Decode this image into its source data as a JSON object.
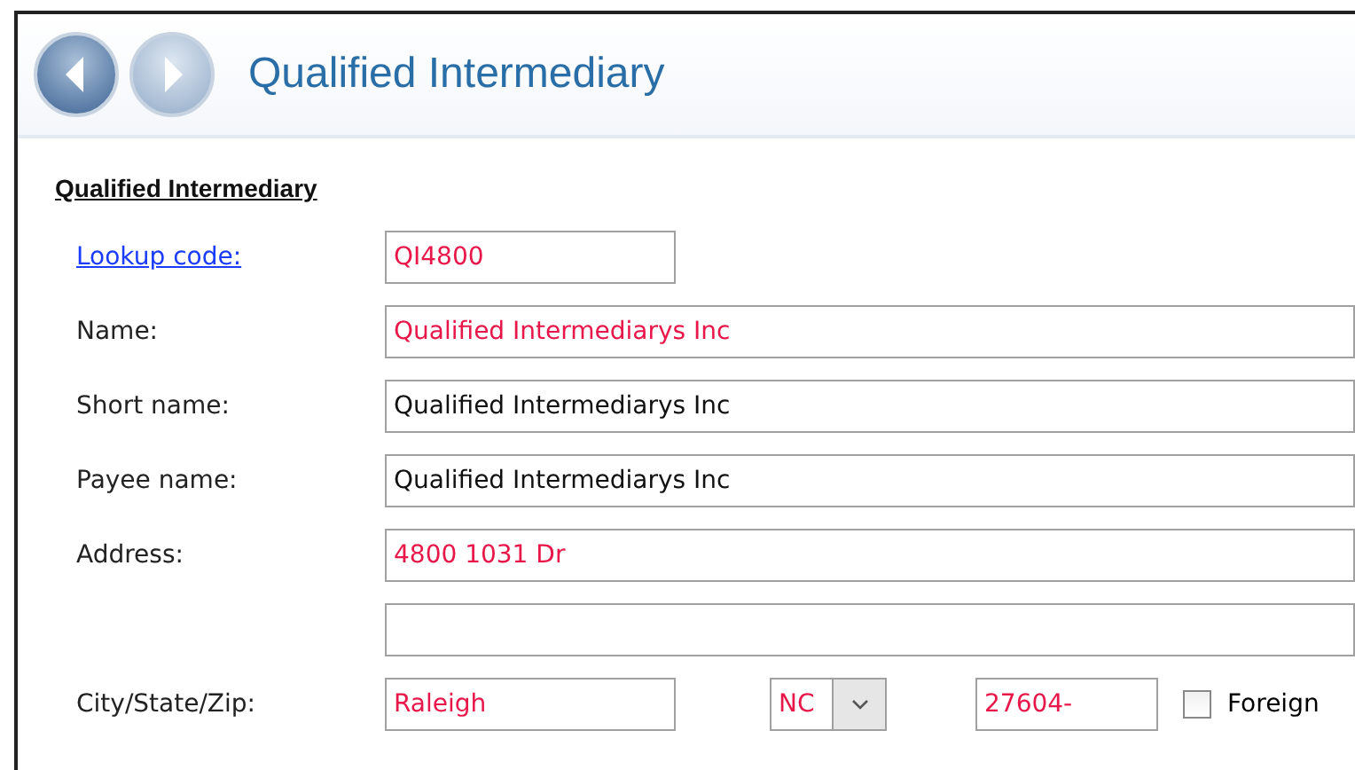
{
  "header": {
    "title": "Qualified Intermediary"
  },
  "section": {
    "title": "Qualified Intermediary"
  },
  "rows": [
    {
      "label": "Lookup code:",
      "kind": "link",
      "fields": [
        {
          "kind": "short",
          "value": "QI4800",
          "required": true
        }
      ]
    },
    {
      "label": "Name:",
      "kind": "plain",
      "fields": [
        {
          "kind": "text",
          "value": "Qualified Intermediarys Inc",
          "required": true
        }
      ]
    },
    {
      "label": "Short name:",
      "kind": "plain",
      "fields": [
        {
          "kind": "text",
          "value": "Qualified Intermediarys Inc",
          "required": false
        }
      ]
    },
    {
      "label": "Payee name:",
      "kind": "plain",
      "fields": [
        {
          "kind": "text",
          "value": "Qualified Intermediarys Inc",
          "required": false
        }
      ]
    },
    {
      "label": "Address:",
      "kind": "plain",
      "fields": [
        {
          "kind": "text",
          "value": "4800 1031 Dr",
          "required": true
        }
      ]
    },
    {
      "kind": "blank",
      "fields": [
        {
          "kind": "text"
        }
      ]
    },
    {
      "label": "City/State/Zip:",
      "kind": "plain",
      "fields": [
        {
          "kind": "short",
          "value": "Raleigh",
          "required": true
        },
        {
          "kind": "combo",
          "value": "NC",
          "required": true
        },
        {
          "kind": "zip",
          "value": "27604-",
          "required": true
        },
        {
          "kind": "checkbox",
          "label": "Foreign",
          "checked": false
        }
      ]
    }
  ]
}
